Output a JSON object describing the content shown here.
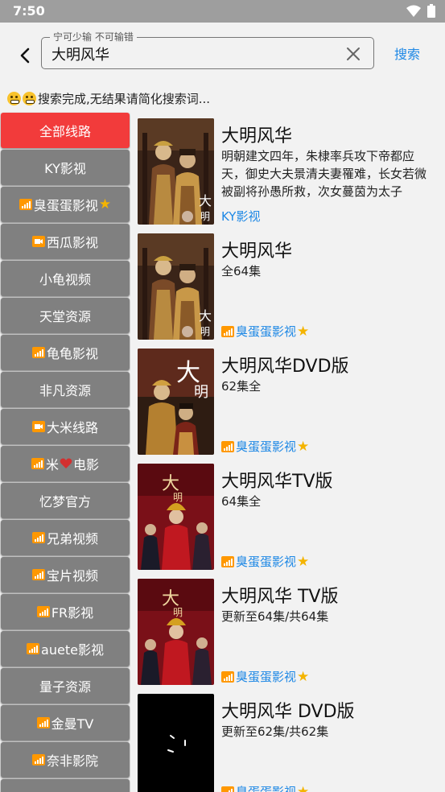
{
  "status_bar": {
    "time": "7:50"
  },
  "search": {
    "hint": "宁可少输 不可输错",
    "query": "大明风华",
    "button": "搜索"
  },
  "message": "搜索完成,无结果请简化搜索词...",
  "routes": [
    {
      "label": "全部线路",
      "icon": "",
      "active": true
    },
    {
      "label": "KY影视",
      "icon": ""
    },
    {
      "label": "臭蛋蛋影视",
      "icon": "signal-icon",
      "suffix": "star-icon"
    },
    {
      "label": "西瓜影视",
      "icon": "camera-icon"
    },
    {
      "label": "小龟视频",
      "icon": ""
    },
    {
      "label": "天堂资源",
      "icon": ""
    },
    {
      "label": "龟龟影视",
      "icon": "signal-icon"
    },
    {
      "label": "非凡资源",
      "icon": ""
    },
    {
      "label": "大米线路",
      "icon": "camera-icon"
    },
    {
      "label_a": "米",
      "label_b": "电影",
      "icon": "signal-icon",
      "middle": "heart-icon"
    },
    {
      "label": "忆梦官方",
      "icon": ""
    },
    {
      "label": "兄弟视频",
      "icon": "signal-icon"
    },
    {
      "label": "宝片视频",
      "icon": "signal-icon"
    },
    {
      "label": "FR影视",
      "icon": "signal-icon"
    },
    {
      "label": "auete影视",
      "icon": "signal-icon"
    },
    {
      "label": "量子资源",
      "icon": ""
    },
    {
      "label": "金曼TV",
      "icon": "signal-icon"
    },
    {
      "label": "奈非影院",
      "icon": "signal-icon"
    }
  ],
  "results": [
    {
      "title": "大明风华",
      "desc": "明朝建文四年，朱棣率兵攻下帝都应天，御史大夫景清夫妻罹难，长女若微被副将孙愚所救，次女蔓茵为太子",
      "source": "KY影视",
      "source_icon": "",
      "poster": "ming-poster-a"
    },
    {
      "title": "大明风华",
      "desc": "全64集",
      "source": "臭蛋蛋影视",
      "source_icon": "signal-icon",
      "poster": "ming-poster-a"
    },
    {
      "title": "大明风华DVD版",
      "desc": "62集全",
      "source": "臭蛋蛋影视",
      "source_icon": "signal-icon",
      "poster": "ming-poster-b"
    },
    {
      "title": "大明风华TV版",
      "desc": "64集全",
      "source": "臭蛋蛋影视",
      "source_icon": "signal-icon",
      "poster": "ming-poster-red"
    },
    {
      "title": "大明风华 TV版",
      "desc": "更新至64集/共64集",
      "source": "臭蛋蛋影视",
      "source_icon": "signal-icon",
      "poster": "ming-poster-red"
    },
    {
      "title": "大明风华 DVD版",
      "desc": "更新至62集/共62集",
      "source": "臭蛋蛋影视",
      "source_icon": "signal-icon",
      "poster": "poster-loading"
    }
  ],
  "colors": {
    "accent": "#1e88e5",
    "active_route": "#f23b3b",
    "route": "#808080",
    "star": "#f4b400"
  }
}
